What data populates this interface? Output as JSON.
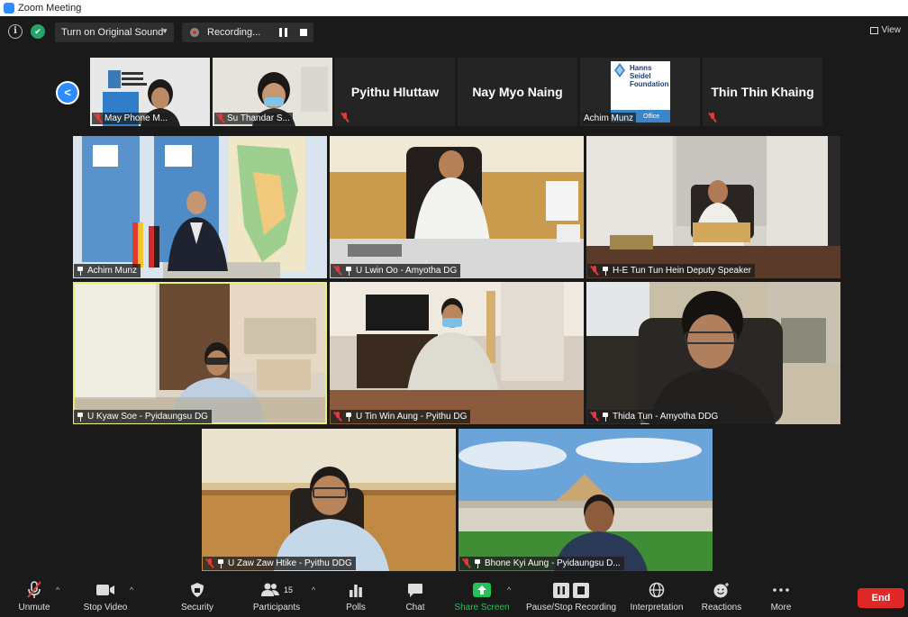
{
  "window": {
    "title": "Zoom Meeting"
  },
  "topbar": {
    "sound_button": "Turn on Original Sound",
    "recording_label": "Recording...",
    "view_label": "View"
  },
  "strip": [
    {
      "name": "May Phone M...",
      "kind": "video"
    },
    {
      "name": "Su Thandar S...",
      "kind": "video"
    },
    {
      "name": "Pyithu Hluttaw",
      "kind": "name"
    },
    {
      "name": "Nay Myo Naing",
      "kind": "name"
    },
    {
      "name": "Achim Munz",
      "kind": "logo"
    },
    {
      "name": "Thin Thin Khaing",
      "kind": "name"
    }
  ],
  "logo": {
    "line1": "Hanns",
    "line2": "Seidel",
    "line3": "Foundation",
    "office": "Office"
  },
  "gallery": [
    {
      "name": "Achim Munz",
      "muted": false
    },
    {
      "name": "U Lwin Oo - Amyotha DG",
      "muted": true
    },
    {
      "name": "H-E Tun Tun Hein Deputy Speaker",
      "muted": true
    },
    {
      "name": "U Kyaw Soe - Pyidaungsu DG",
      "muted": true,
      "active": true
    },
    {
      "name": "U Tin Win Aung - Pyithu DG",
      "muted": true
    },
    {
      "name": "Thida Tun - Amyotha DDG",
      "muted": true
    },
    {
      "name": "U Zaw Zaw Htike - Pyithu DDG",
      "muted": true
    },
    {
      "name": "Bhone Kyi Aung - Pyidaungsu D...",
      "muted": true
    }
  ],
  "toolbar": {
    "unmute": "Unmute",
    "stop_video": "Stop Video",
    "security": "Security",
    "participants": "Participants",
    "participants_count": "15",
    "polls": "Polls",
    "chat": "Chat",
    "share_screen": "Share Screen",
    "pause_stop_recording": "Pause/Stop Recording",
    "interpretation": "Interpretation",
    "reactions": "Reactions",
    "more": "More",
    "end": "End"
  },
  "colors": {
    "accent": "#2d8cff",
    "share_green": "#23c05b",
    "end_red": "#e02828",
    "active_speaker": "#e8f07a"
  }
}
